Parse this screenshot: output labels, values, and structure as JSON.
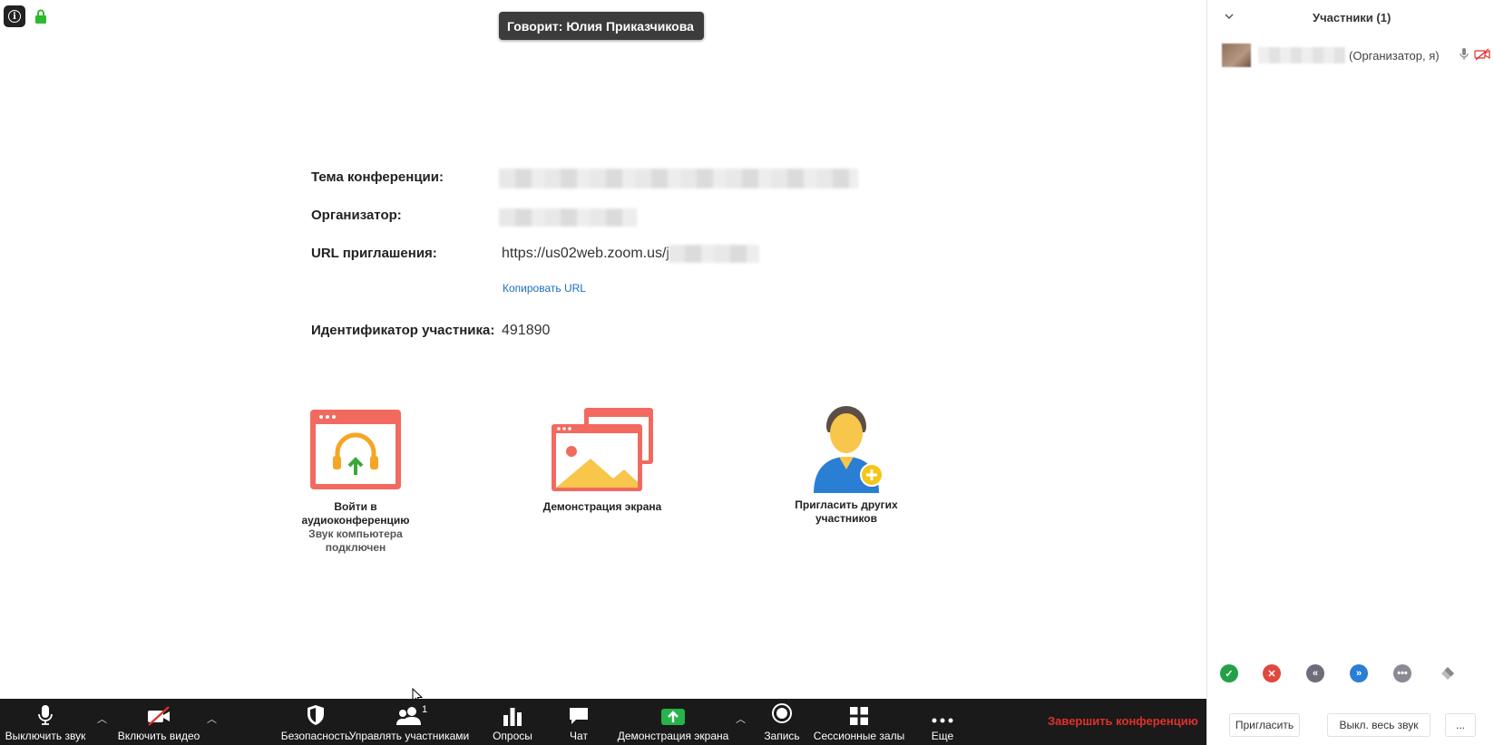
{
  "speaker": {
    "text": "Говорит: Юлия Приказчикова"
  },
  "meeting": {
    "topic_label": "Тема конференции:",
    "organizer_label": "Организатор:",
    "url_label": "URL приглашения:",
    "url_value": "https://us02web.zoom.us/j",
    "copy_url": "Копировать URL",
    "participant_id_label": "Идентификатор участника:",
    "participant_id_value": "491890"
  },
  "actions": {
    "audio_label": "Войти в аудиоконференцию",
    "audio_sub": "Звук компьютера подключен",
    "share_label": "Демонстрация экрана",
    "invite_label": "Пригласить других участников"
  },
  "toolbar": {
    "mute": "Выключить звук",
    "video": "Включить видео",
    "security": "Безопасность",
    "participants": "Управлять участниками",
    "participants_count": "1",
    "polls": "Опросы",
    "chat": "Чат",
    "share": "Демонстрация экрана",
    "record": "Запись",
    "breakout": "Сессионные залы",
    "more": "Еще",
    "end": "Завершить конференцию"
  },
  "panel": {
    "title": "Участники (1)",
    "participant_role": "(Организатор, я)",
    "invite": "Пригласить",
    "mute_all": "Выкл. весь звук",
    "more": "..."
  },
  "colors": {
    "accent_red": "#e0312b",
    "link_blue": "#1a6dbf",
    "toolbar_bg": "#1a1a1a",
    "share_green": "#26b34a"
  }
}
